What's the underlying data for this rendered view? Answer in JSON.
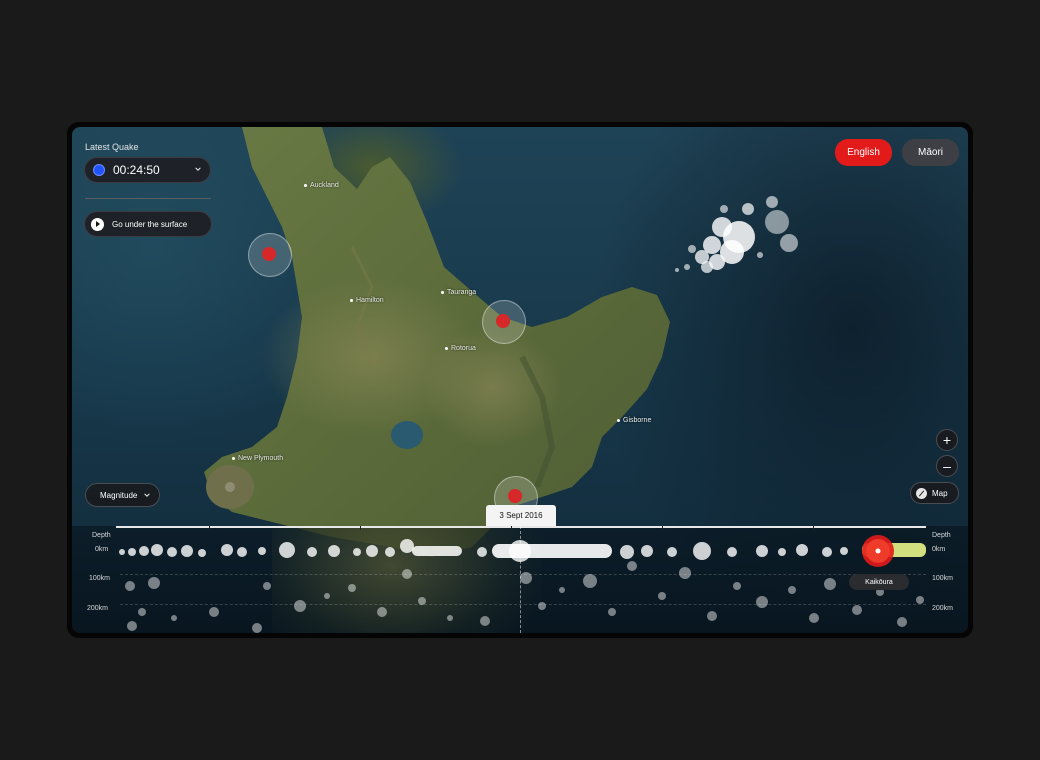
{
  "latest_quake": {
    "title": "Latest Quake",
    "time": "00:24:50"
  },
  "actions": {
    "surface": "Go under the surface",
    "magnitude": "Magnitude",
    "map": "Map"
  },
  "language": {
    "english": "English",
    "maori": "Māori"
  },
  "zoom": {
    "in": "+",
    "out": "–"
  },
  "places": [
    {
      "name": "Auckland"
    },
    {
      "name": "Tauranga"
    },
    {
      "name": "Hamilton"
    },
    {
      "name": "Rotorua"
    },
    {
      "name": "Gisborne"
    },
    {
      "name": "New Plymouth"
    }
  ],
  "timeline": {
    "depth_title_left": "Depth",
    "depth_title_right": "Depth",
    "depths": [
      "0km",
      "100km",
      "200km"
    ],
    "selected_date": "3 Sept 2016",
    "highlight_label": "Kaikōura"
  },
  "colors": {
    "accent": "#e31a1a",
    "quake_marker": "#d62828",
    "live_indicator": "#1f54ff",
    "highlight_band": "#e8f58a"
  }
}
